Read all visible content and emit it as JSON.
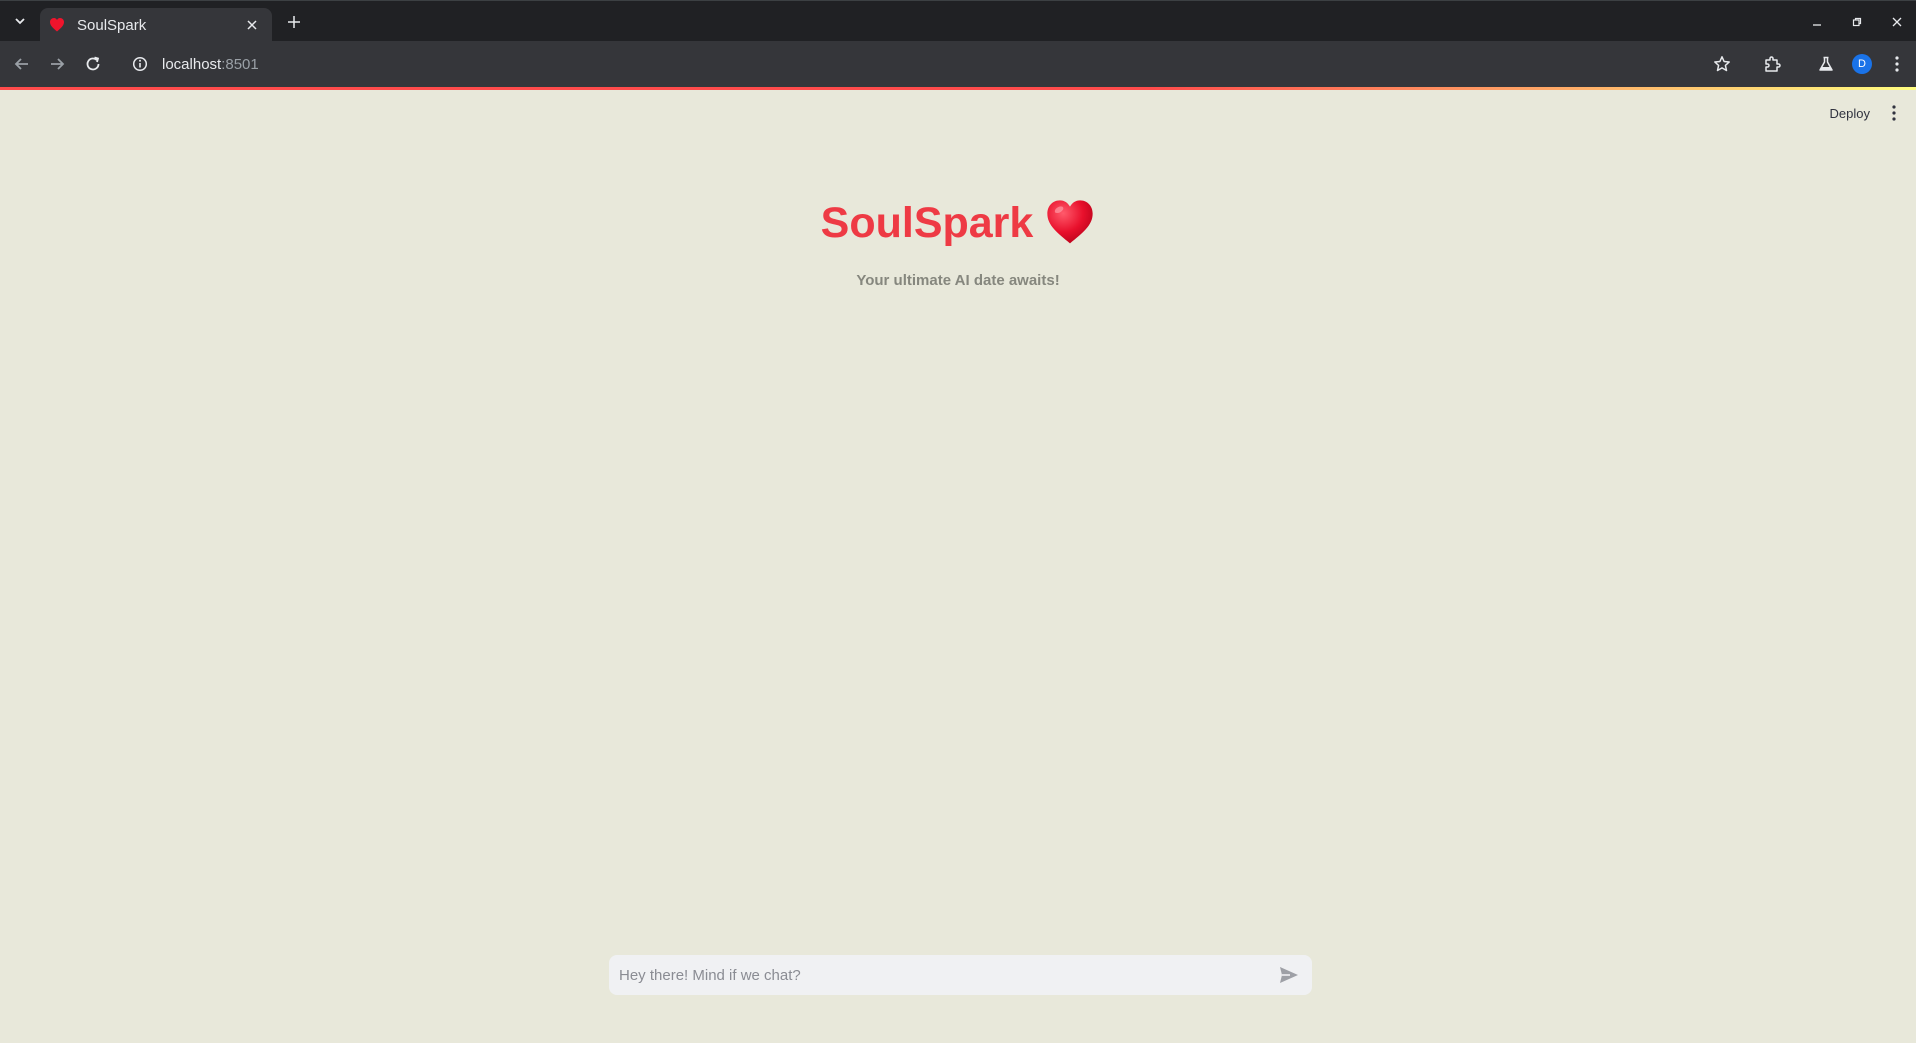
{
  "browser": {
    "tab_title": "SoulSpark",
    "url_host": "localhost",
    "url_port": ":8501",
    "profile_initial": "D"
  },
  "app": {
    "deploy_label": "Deploy",
    "title": "SoulSpark",
    "subtitle": "Your ultimate AI date awaits!",
    "chat_placeholder": "Hey there! Mind if we chat?"
  },
  "colors": {
    "accent": "#ee3a44",
    "page_background": "#e8e8da",
    "chat_input_background": "#f0f1f3"
  },
  "icons": {
    "tab_favicon": "heart-icon",
    "title_emoji": "heart-icon",
    "send": "send-icon"
  }
}
